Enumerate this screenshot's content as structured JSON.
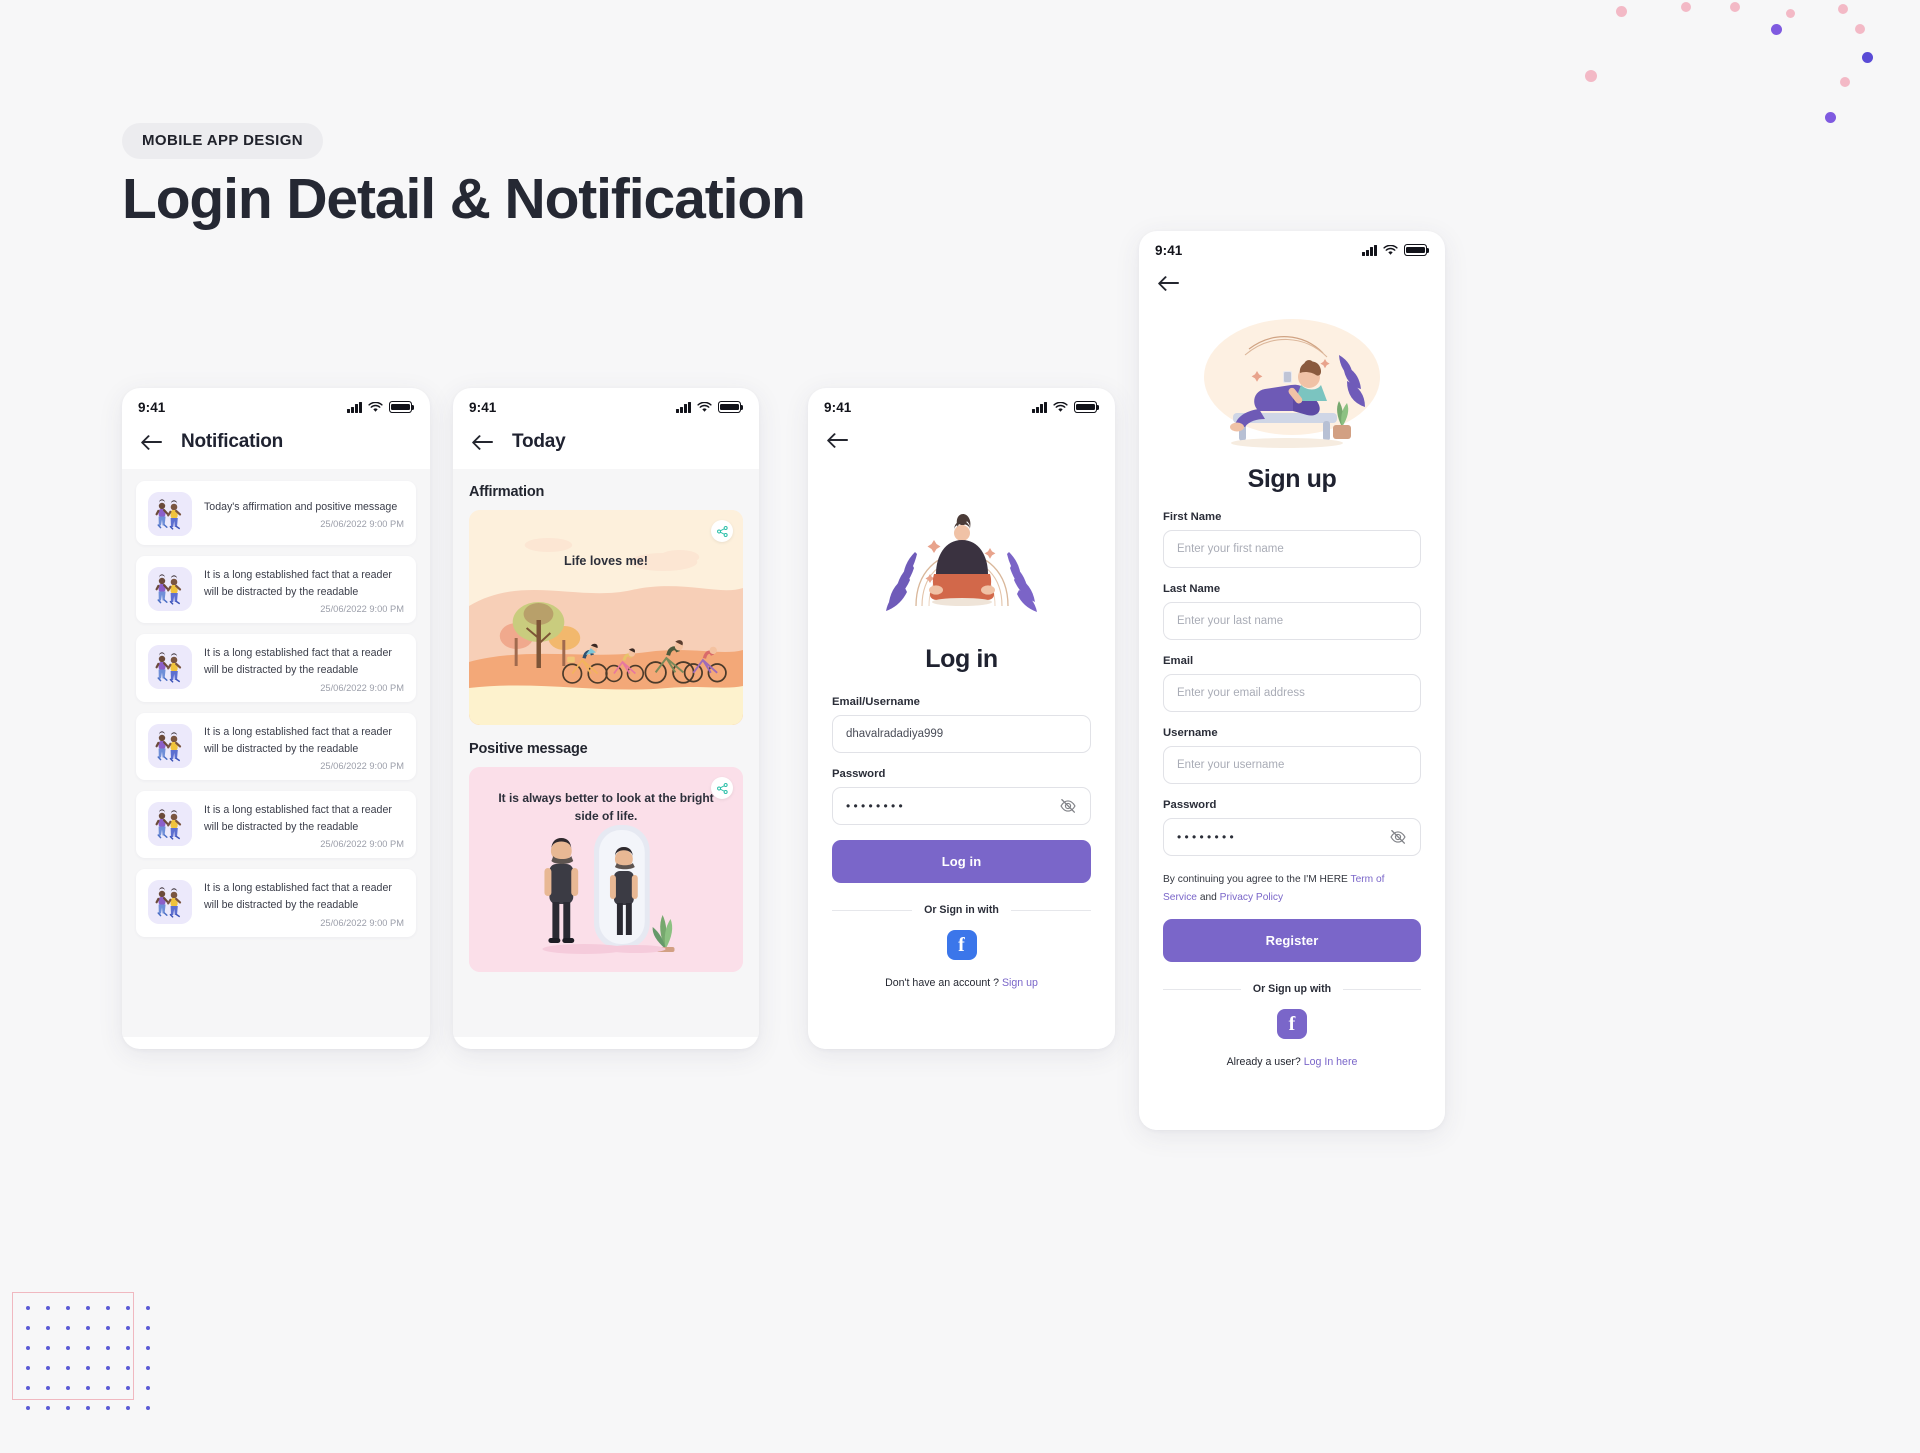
{
  "header": {
    "badge": "MOBILE APP DESIGN",
    "title": "Login Detail & Notification"
  },
  "colors": {
    "primary_purple": "#7a66c9",
    "facebook_blue": "#3b76ea",
    "share_teal": "#2bbfa8",
    "page_bg": "#f7f7f8",
    "screen_bg": "#f6f6f7",
    "affirmation_card": "#fdf0dc",
    "positive_card": "#fbdfe9",
    "thumb_bg": "#ece9fb"
  },
  "status_bar": {
    "time": "9:41"
  },
  "screens": {
    "notification": {
      "title": "Notification",
      "items": [
        {
          "text": "Today's affirmation and positive message",
          "time": "25/06/2022 9:00 PM",
          "lines": 1
        },
        {
          "text": "It is a long established fact that a reader will be distracted by the readable",
          "time": "25/06/2022 9:00 PM",
          "lines": 2
        },
        {
          "text": "It is a long established fact that a reader will be distracted by the readable",
          "time": "25/06/2022 9:00 PM",
          "lines": 2
        },
        {
          "text": "It is a long established fact that a reader will be distracted by the readable",
          "time": "25/06/2022 9:00 PM",
          "lines": 2
        },
        {
          "text": "It is a long established fact that a reader will be distracted by the readable",
          "time": "25/06/2022 9:00 PM",
          "lines": 2
        },
        {
          "text": "It is a long established fact that a reader will be distracted by the readable",
          "time": "25/06/2022 9:00 PM",
          "lines": 2
        }
      ]
    },
    "today": {
      "title": "Today",
      "affirmation_heading": "Affirmation",
      "affirmation_quote": "Life loves me!",
      "positive_heading": "Positive message",
      "positive_quote": "It is always better to look at the bright side of life."
    },
    "login": {
      "title": "Log in",
      "email_label": "Email/Username",
      "email_value": "dhavalradadiya999",
      "password_label": "Password",
      "password_value": "••••••••",
      "submit_label": "Log in",
      "or_label": "Or Sign in with",
      "social": "facebook",
      "footer_prefix": "Don't have an account ?",
      "footer_link": "Sign up"
    },
    "signup": {
      "title": "Sign up",
      "fields": [
        {
          "label": "First Name",
          "placeholder": "Enter your first name",
          "value": "",
          "type": "text"
        },
        {
          "label": "Last Name",
          "placeholder": "Enter your last name",
          "value": "",
          "type": "text"
        },
        {
          "label": "Email",
          "placeholder": "Enter your email address",
          "value": "",
          "type": "text"
        },
        {
          "label": "Username",
          "placeholder": "Enter your username",
          "value": "",
          "type": "text"
        },
        {
          "label": "Password",
          "placeholder": "",
          "value": "••••••••",
          "type": "password"
        }
      ],
      "terms_prefix": "By continuing you agree to the I'M HERE",
      "terms_link1": "Term of Service",
      "terms_and": "and",
      "terms_link2": "Privacy Policy",
      "submit_label": "Register",
      "or_label": "Or Sign up with",
      "social": "facebook",
      "footer_prefix": "Already a user?",
      "footer_link": "Log In here"
    }
  }
}
